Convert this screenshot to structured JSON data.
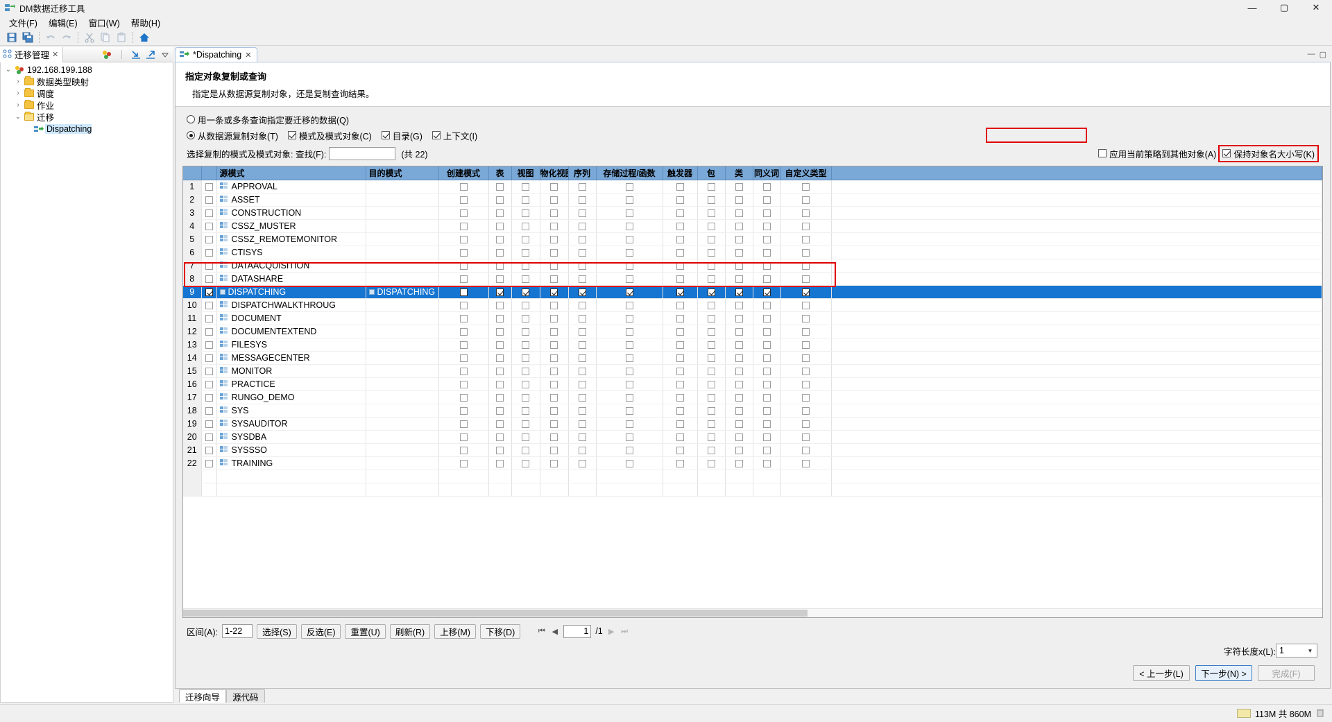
{
  "window": {
    "title": "DM数据迁移工具",
    "app_icon": "migration-app-icon",
    "minimize": "—",
    "maximize": "▢",
    "close": "✕"
  },
  "menubar": {
    "items": [
      {
        "label": "文件(F)",
        "name": "menu-file"
      },
      {
        "label": "编辑(E)",
        "name": "menu-edit"
      },
      {
        "label": "窗口(W)",
        "name": "menu-window"
      },
      {
        "label": "帮助(H)",
        "name": "menu-help"
      }
    ]
  },
  "toolbar": {
    "buttons": [
      {
        "icon": "save-icon"
      },
      {
        "icon": "save-all-icon"
      },
      {
        "icon": "undo-icon"
      },
      {
        "icon": "redo-icon"
      },
      {
        "icon": "cut-icon"
      },
      {
        "icon": "copy-icon"
      },
      {
        "icon": "paste-icon"
      },
      {
        "icon": "home-icon"
      }
    ]
  },
  "left_panel": {
    "view_tab": {
      "label": "迁移管理",
      "close": "✕"
    },
    "tools": [
      "connections-icon",
      "import-icon",
      "export-icon",
      "view-menu-icon"
    ],
    "minimize": "—",
    "maximize": "▢",
    "tree": [
      {
        "label": "192.168.199.188",
        "arrow": "⌄",
        "icon": "server-icon",
        "indent": 0,
        "selected": false
      },
      {
        "label": "数据类型映射",
        "arrow": "›",
        "icon": "folder-icon",
        "indent": 1,
        "selected": false
      },
      {
        "label": "调度",
        "arrow": "›",
        "icon": "folder-icon",
        "indent": 1,
        "selected": false
      },
      {
        "label": "作业",
        "arrow": "›",
        "icon": "folder-icon",
        "indent": 1,
        "selected": false
      },
      {
        "label": "迁移",
        "arrow": "⌄",
        "icon": "folder-open-icon",
        "indent": 1,
        "selected": false
      },
      {
        "label": "Dispatching",
        "arrow": "",
        "icon": "migration-icon",
        "indent": 2,
        "selected": true
      }
    ]
  },
  "editor": {
    "tab": {
      "label": "*Dispatching",
      "icon": "migration-icon",
      "close": "✕"
    },
    "minimize": "—",
    "maximize": "▢",
    "wizard_title": "指定对象复制或查询",
    "wizard_subtitle": "指定是从数据源复制对象，还是复制查询结果。",
    "options": {
      "radio_query": {
        "label": "用一条或多条查询指定要迁移的数据(Q)",
        "checked": false
      },
      "radio_copy": {
        "label": "从数据源复制对象(T)",
        "checked": true
      },
      "cb_schema_objects": {
        "label": "模式及模式对象(C)",
        "checked": true
      },
      "cb_catalog": {
        "label": "目录(G)",
        "checked": true
      },
      "cb_context": {
        "label": "上下文(I)",
        "checked": true
      }
    },
    "select_row": {
      "label": "选择复制的模式及模式对象: 查找(F):",
      "find_value": "",
      "find_placeholder": "",
      "count_text": "(共 22)"
    },
    "right_options": {
      "apply_policy": {
        "label": "应用当前策略到其他对象(A)",
        "checked": false
      },
      "keep_case": {
        "label": "保持对象名大小写(K)",
        "checked": true
      }
    },
    "table": {
      "columns": [
        "源模式",
        "目的模式",
        "创建模式",
        "表",
        "视图",
        "物化视图",
        "序列",
        "存储过程/函数",
        "触发器",
        "包",
        "类",
        "同义词",
        "自定义类型"
      ],
      "rows": [
        {
          "num": "1",
          "source": "APPROVAL",
          "dest": "",
          "selected": false,
          "row_checked": false
        },
        {
          "num": "2",
          "source": "ASSET",
          "dest": "",
          "selected": false,
          "row_checked": false
        },
        {
          "num": "3",
          "source": "CONSTRUCTION",
          "dest": "",
          "selected": false,
          "row_checked": false
        },
        {
          "num": "4",
          "source": "CSSZ_MUSTER",
          "dest": "",
          "selected": false,
          "row_checked": false
        },
        {
          "num": "5",
          "source": "CSSZ_REMOTEMONITOR",
          "dest": "",
          "selected": false,
          "row_checked": false
        },
        {
          "num": "6",
          "source": "CTISYS",
          "dest": "",
          "selected": false,
          "row_checked": false
        },
        {
          "num": "7",
          "source": "DATAACQUISITION",
          "dest": "",
          "selected": false,
          "row_checked": false
        },
        {
          "num": "8",
          "source": "DATASHARE",
          "dest": "",
          "selected": false,
          "row_checked": false
        },
        {
          "num": "9",
          "source": "DISPATCHING",
          "dest": "DISPATCHING",
          "selected": true,
          "row_checked": true
        },
        {
          "num": "10",
          "source": "DISPATCHWALKTHROUG",
          "dest": "",
          "selected": false,
          "row_checked": false
        },
        {
          "num": "11",
          "source": "DOCUMENT",
          "dest": "",
          "selected": false,
          "row_checked": false
        },
        {
          "num": "12",
          "source": "DOCUMENTEXTEND",
          "dest": "",
          "selected": false,
          "row_checked": false
        },
        {
          "num": "13",
          "source": "FILESYS",
          "dest": "",
          "selected": false,
          "row_checked": false
        },
        {
          "num": "14",
          "source": "MESSAGECENTER",
          "dest": "",
          "selected": false,
          "row_checked": false
        },
        {
          "num": "15",
          "source": "MONITOR",
          "dest": "",
          "selected": false,
          "row_checked": false
        },
        {
          "num": "16",
          "source": "PRACTICE",
          "dest": "",
          "selected": false,
          "row_checked": false
        },
        {
          "num": "17",
          "source": "RUNGO_DEMO",
          "dest": "",
          "selected": false,
          "row_checked": false
        },
        {
          "num": "18",
          "source": "SYS",
          "dest": "",
          "selected": false,
          "row_checked": false
        },
        {
          "num": "19",
          "source": "SYSAUDITOR",
          "dest": "",
          "selected": false,
          "row_checked": false
        },
        {
          "num": "20",
          "source": "SYSDBA",
          "dest": "",
          "selected": false,
          "row_checked": false
        },
        {
          "num": "21",
          "source": "SYSSSO",
          "dest": "",
          "selected": false,
          "row_checked": false
        },
        {
          "num": "22",
          "source": "TRAINING",
          "dest": "",
          "selected": false,
          "row_checked": false
        }
      ],
      "selected_row_checks": {
        "create_schema": false,
        "table": true,
        "view": true,
        "mview": true,
        "sequence": true,
        "procedure": true,
        "trigger": true,
        "package": true,
        "class": true,
        "synonym": true,
        "udt": true
      }
    },
    "bottom_controls": {
      "range_label": "区间(A):",
      "range_value": "1-22",
      "buttons": [
        {
          "label": "选择(S)",
          "name": "select-button"
        },
        {
          "label": "反选(E)",
          "name": "invert-select-button"
        },
        {
          "label": "重置(U)",
          "name": "reset-button"
        },
        {
          "label": "刷新(R)",
          "name": "refresh-button"
        },
        {
          "label": "上移(M)",
          "name": "move-up-button"
        },
        {
          "label": "下移(D)",
          "name": "move-down-button"
        }
      ],
      "pager": {
        "first": "⏮",
        "prev": "◀",
        "next": "▶",
        "last": "⏭",
        "page_value": "1",
        "page_total": "/1"
      }
    },
    "charlen": {
      "label": "字符长度x(L):",
      "value": "1"
    },
    "wizard_buttons": {
      "back": "< 上一步(L)",
      "next": "下一步(N) >",
      "finish": "完成(F)"
    },
    "bottom_tabs": [
      {
        "label": "迁移向导",
        "active": true
      },
      {
        "label": "源代码",
        "active": false
      }
    ]
  },
  "statusbar": {
    "memory": "113M 共 860M",
    "trash_icon": "trash-icon"
  },
  "colors": {
    "accent": "#1675d1",
    "header": "#7aa9d8",
    "annotation": "#e00000"
  }
}
